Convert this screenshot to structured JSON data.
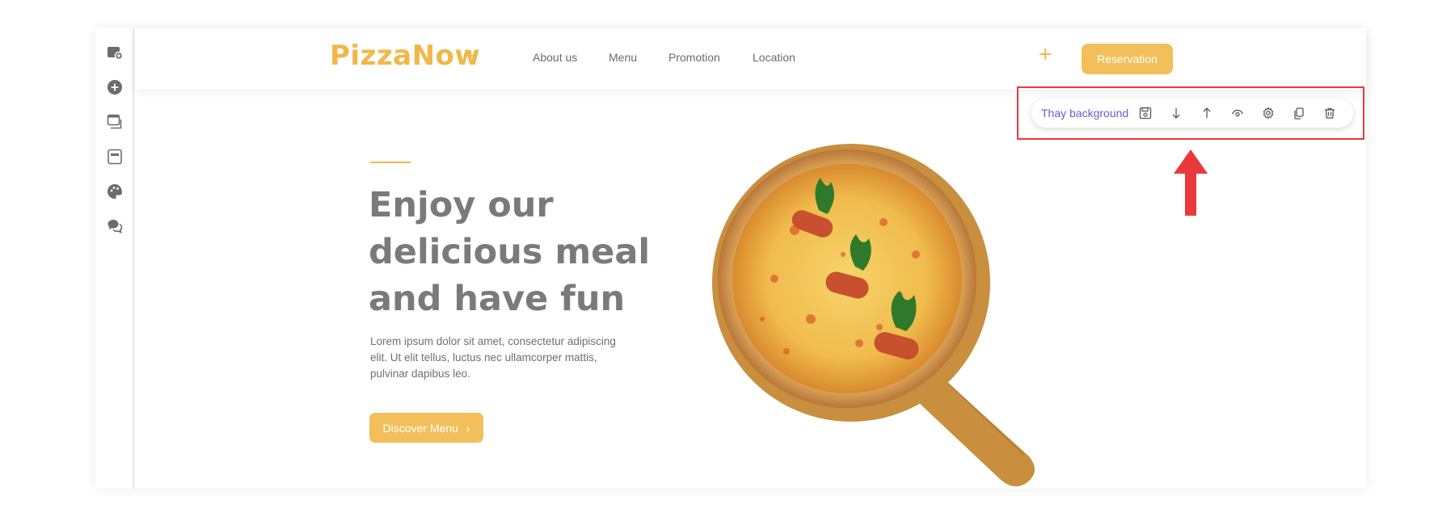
{
  "header": {
    "logo": "PizzaNow",
    "nav": [
      "About us",
      "Menu",
      "Promotion",
      "Location"
    ],
    "reservation_label": "Reservation"
  },
  "toolbar": {
    "label": "Thay background",
    "icons": [
      "save-icon",
      "arrow-down-icon",
      "arrow-up-icon",
      "eye-icon",
      "gear-icon",
      "copy-icon",
      "trash-icon"
    ]
  },
  "left_rail": {
    "icons": [
      "add-image-icon",
      "add-circle-icon",
      "windows-icon",
      "layout-icon",
      "palette-icon",
      "chat-icon"
    ]
  },
  "hero": {
    "headline": [
      "Enjoy our",
      "delicious meal",
      "and have fun"
    ],
    "body": "Lorem ipsum dolor sit amet, consectetur adipiscing elit. Ut elit tellus, luctus nec ullamcorper mattis, pulvinar dapibus leo.",
    "cta_label": "Discover Menu",
    "cta_icon": "›"
  },
  "colors": {
    "accent": "#f0b84a",
    "button": "#f2bf5a",
    "toolbar_label": "#6a5bd8",
    "highlight": "#e8393b",
    "headline": "#7a7a7a"
  }
}
